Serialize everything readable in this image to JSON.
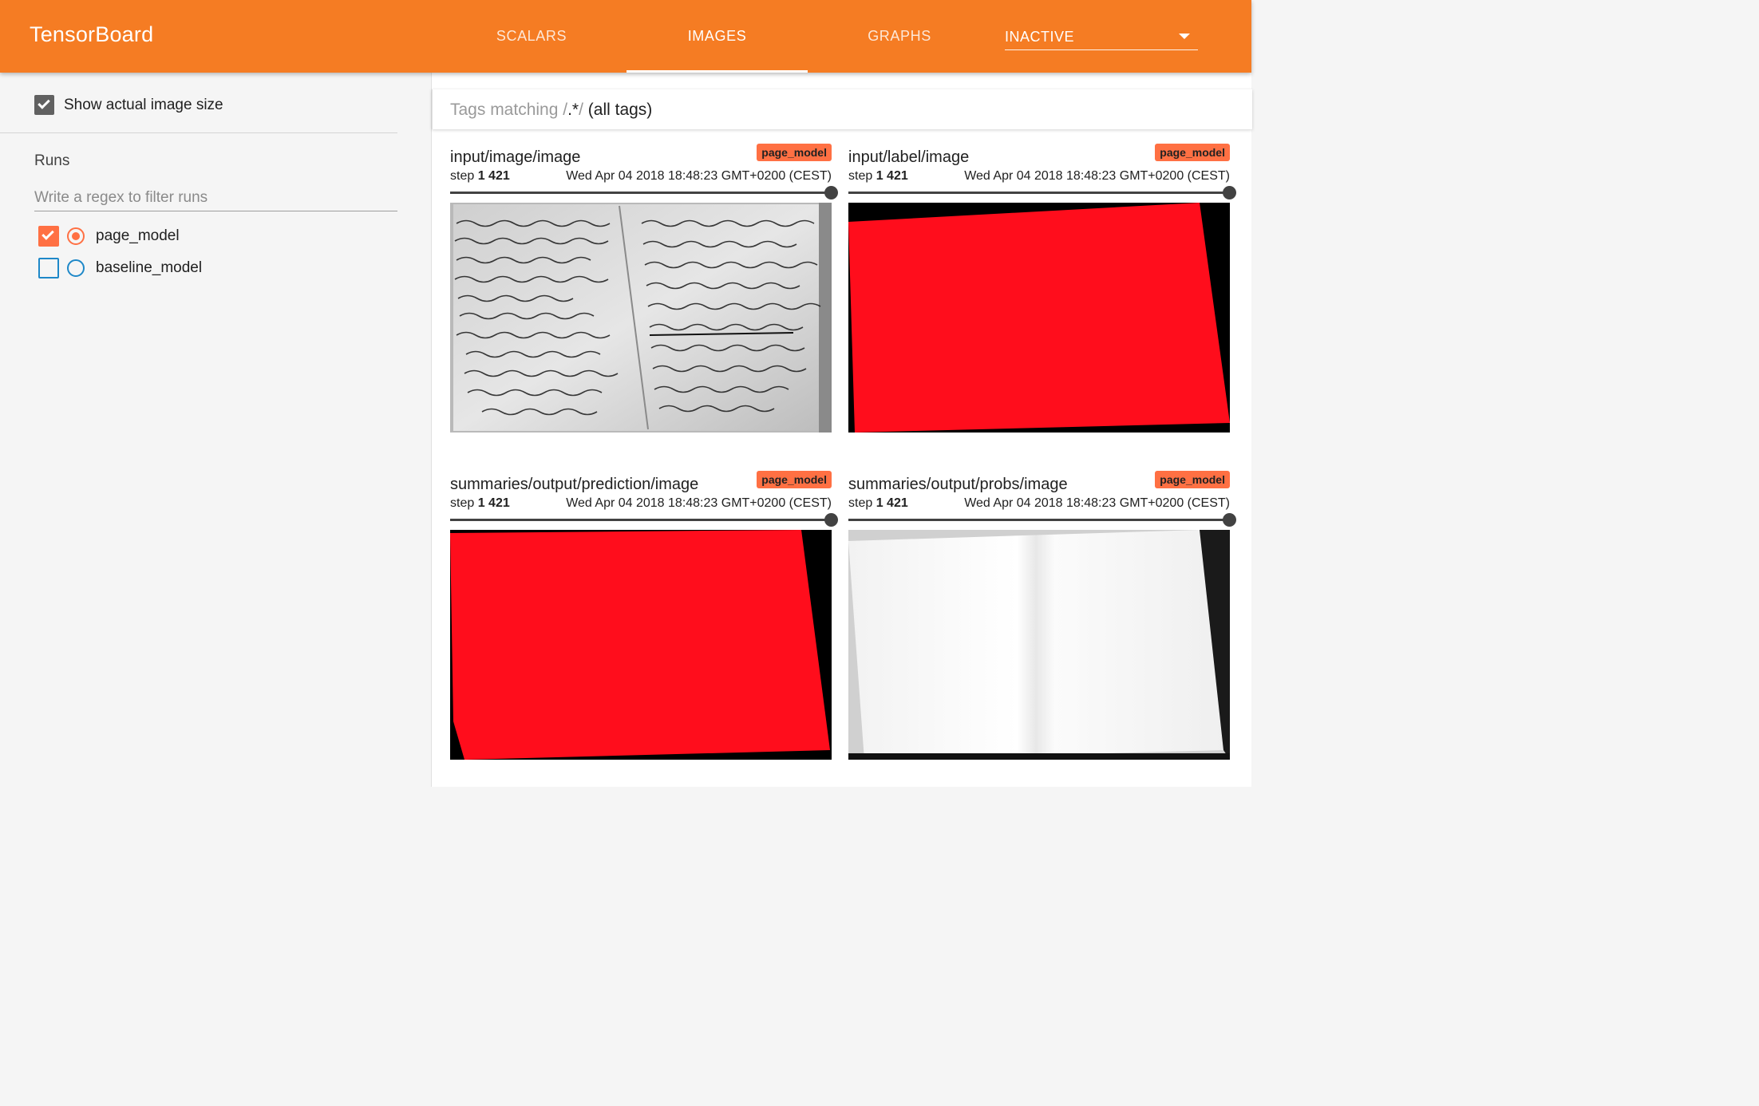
{
  "app": {
    "title": "TensorBoard"
  },
  "header": {
    "tabs": [
      {
        "label": "SCALARS",
        "active": false
      },
      {
        "label": "IMAGES",
        "active": true
      },
      {
        "label": "GRAPHS",
        "active": false
      }
    ],
    "inactive_select": {
      "value": "INACTIVE"
    }
  },
  "sidebar": {
    "show_actual_size": {
      "label": "Show actual image size",
      "checked": true
    },
    "runs_title": "Runs",
    "runs_filter_placeholder": "Write a regex to filter runs",
    "runs": [
      {
        "name": "page_model",
        "checked": true,
        "selected": true
      },
      {
        "name": "baseline_model",
        "checked": false,
        "selected": false
      }
    ]
  },
  "main": {
    "tags": {
      "prefix": "Tags matching /",
      "regex": ".*",
      "suffix": "/",
      "all_tags": "(all tags)"
    },
    "cards": [
      {
        "tag": "input/image/image",
        "run": "page_model",
        "step_label": "step",
        "step": "1 421",
        "timestamp": "Wed Apr 04 2018 18:48:23 GMT+0200 (CEST)",
        "image": "handwritten-open-book-photo"
      },
      {
        "tag": "input/label/image",
        "run": "page_model",
        "step_label": "step",
        "step": "1 421",
        "timestamp": "Wed Apr 04 2018 18:48:23 GMT+0200 (CEST)",
        "image": "red-page-label-mask"
      },
      {
        "tag": "summaries/output/prediction/image",
        "run": "page_model",
        "step_label": "step",
        "step": "1 421",
        "timestamp": "Wed Apr 04 2018 18:48:23 GMT+0200 (CEST)",
        "image": "red-page-prediction-mask"
      },
      {
        "tag": "summaries/output/probs/image",
        "run": "page_model",
        "step_label": "step",
        "step": "1 421",
        "timestamp": "Wed Apr 04 2018 18:48:23 GMT+0200 (CEST)",
        "image": "white-page-probability-map"
      }
    ]
  },
  "colors": {
    "header": "#f57c23",
    "run_accent": "#ff7043",
    "unchecked_run": "#1e88c8",
    "mask_red": "#ff0d1c"
  }
}
